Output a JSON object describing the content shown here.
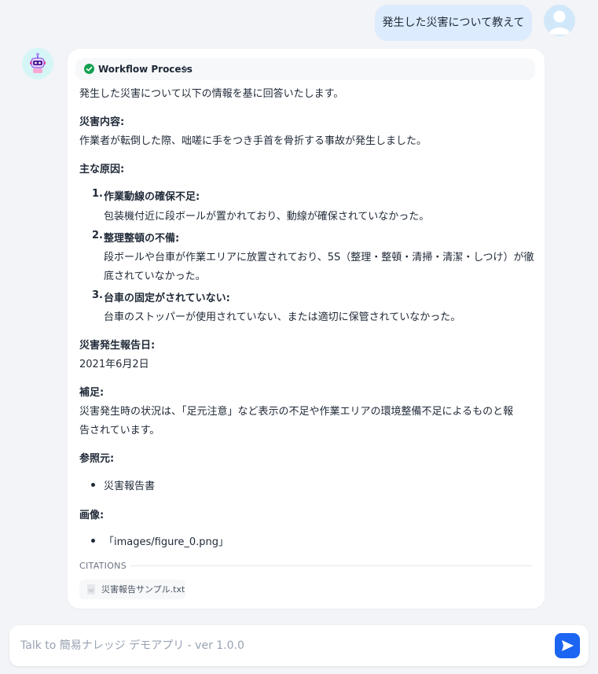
{
  "user_message": "発生した災害について教えて",
  "workflow": {
    "label": "Workflow Process"
  },
  "answer": {
    "intro": "発生した災害について以下の情報を基に回答いたします。",
    "content_heading": "災害内容:",
    "content_text": "作業者が転倒した際、咄嗟に手をつき手首を骨折する事故が発生しました。",
    "causes_heading": "主な原因:",
    "causes": [
      {
        "num": "1.",
        "title": "作業動線の確保不足:",
        "lines": [
          "包装機付近に段ボールが置かれており、動線が確保されていなかった。"
        ]
      },
      {
        "num": "2.",
        "title": "整理整頓の不備:",
        "lines": [
          "段ボールや台車が作業エリアに放置されており、5S（整理・整頓・清掃・清潔・しつけ）が徹",
          "底されていなかった。"
        ]
      },
      {
        "num": "3.",
        "title": "台車の固定がされていない:",
        "lines": [
          "台車のストッパーが使用されていない、または適切に保管されていなかった。"
        ]
      }
    ],
    "date_heading": "災害発生報告日:",
    "date_text": "2021年6月2日",
    "note_heading": "補足:",
    "note_lines": [
      "災害発生時の状況は、「足元注意」など表示の不足や作業エリアの環境整備不足によるものと報",
      "告されています。"
    ],
    "source_heading": "参照元:",
    "source_items": [
      "災害報告書"
    ],
    "image_heading": "画像:",
    "image_items": [
      "「images/figure_0.png」"
    ]
  },
  "citations": {
    "label": "CITATIONS",
    "items": [
      {
        "name": "災害報告サンプル.txt",
        "icon_text": "TXT"
      }
    ]
  },
  "composer": {
    "placeholder": "Talk to 簡易ナレッジ デモアプリ - ver 1.0.0",
    "value": ""
  },
  "colors": {
    "user_bubble": "#dcebfd",
    "accent": "#1c64f2",
    "success": "#12a150",
    "background": "#f2f4f7"
  },
  "icons": [
    "user-avatar-icon",
    "bot-avatar-icon",
    "check-circle-icon",
    "chevron-right-icon",
    "file-icon",
    "send-icon"
  ]
}
